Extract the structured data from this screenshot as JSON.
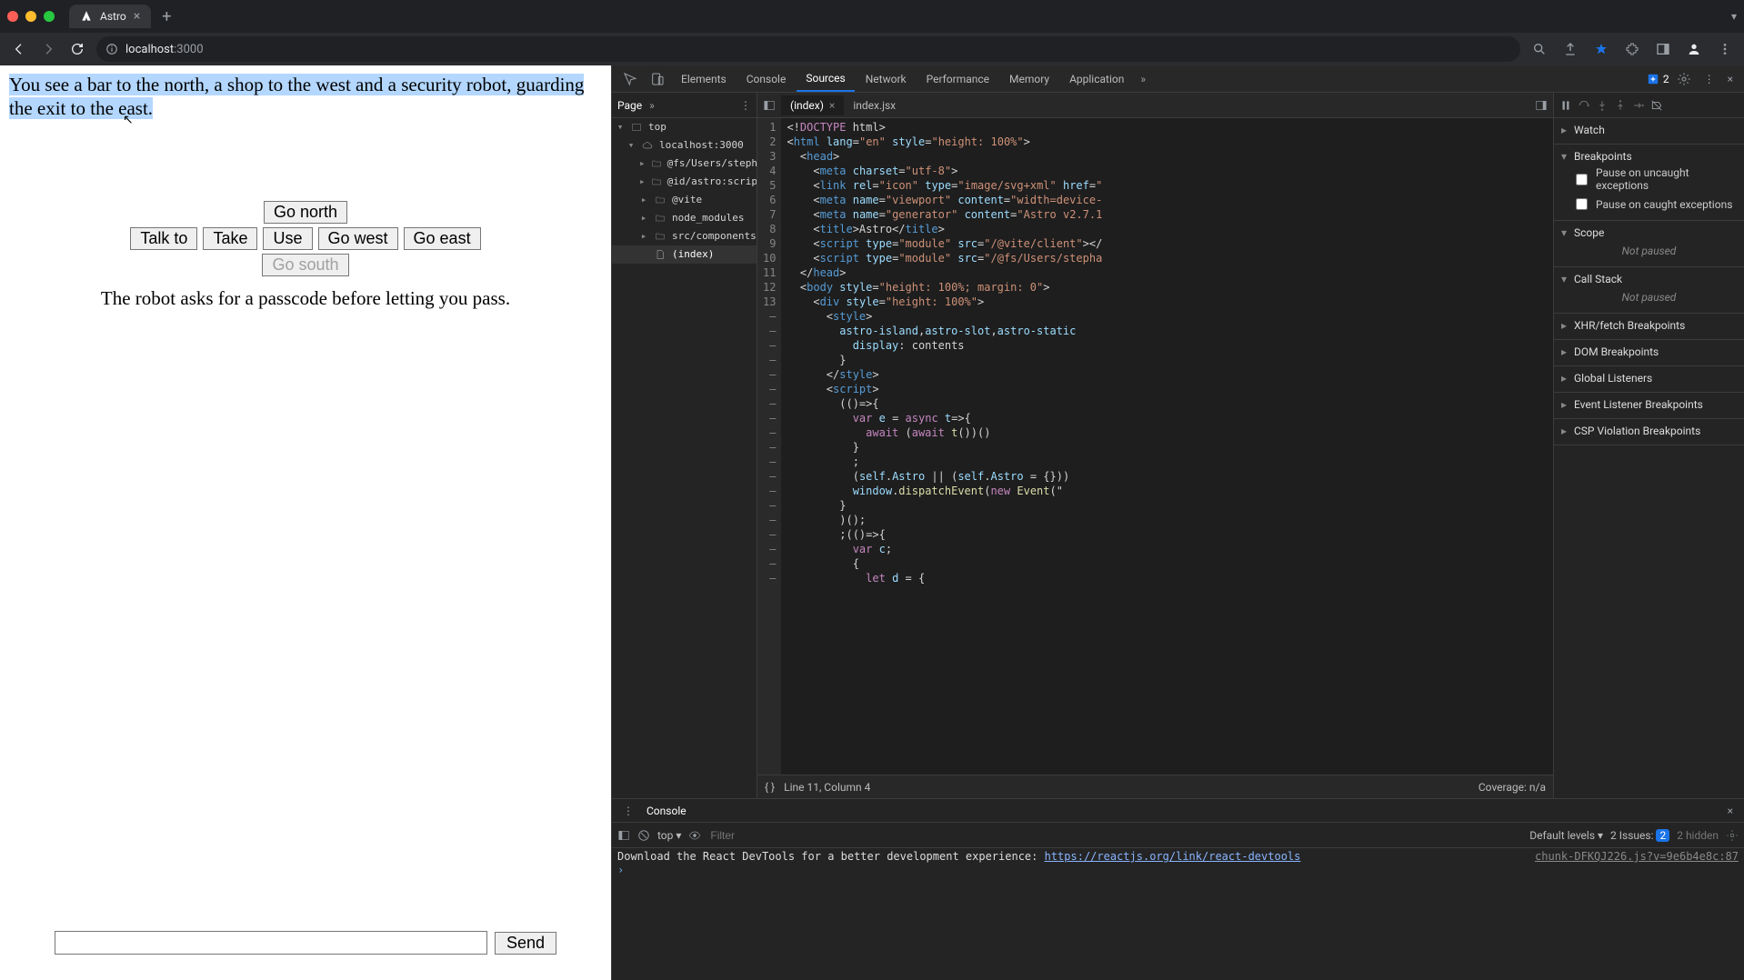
{
  "browser": {
    "tab_title": "Astro",
    "url_host": "localhost",
    "url_port": ":3000"
  },
  "game": {
    "description_hl": "You see a bar to the north, a shop to the west and a security robot, guarding the exit to the east.",
    "buttons": {
      "north": "Go north",
      "talk": "Talk to",
      "take": "Take",
      "use": "Use",
      "west": "Go west",
      "east": "Go east",
      "south": "Go south"
    },
    "dialog": "The robot asks for a passcode before letting you pass.",
    "send_label": "Send",
    "input_value": ""
  },
  "devtools": {
    "top_tabs": [
      "Elements",
      "Console",
      "Sources",
      "Network",
      "Performance",
      "Memory",
      "Application"
    ],
    "issues_count": "2",
    "nav": {
      "tab": "Page",
      "tree": {
        "top": "top",
        "host": "localhost:3000",
        "folders": [
          "@fs/Users/stepha",
          "@id/astro:scripts",
          "@vite",
          "node_modules",
          "src/components"
        ],
        "file": "(index)"
      }
    },
    "editor": {
      "tabs": [
        "(index)",
        "index.jsx"
      ],
      "line_numbers": [
        "1",
        "2",
        "3",
        "4",
        "5",
        "6",
        "7",
        "8",
        "9",
        "10",
        "11",
        "12",
        "13",
        "–",
        "–",
        "–",
        "–",
        "–",
        "–",
        "–",
        "–",
        "–",
        "–",
        "–",
        "–",
        "–",
        "–",
        "–",
        "–",
        "–",
        "–",
        "–"
      ],
      "status_line": "Line 11, Column 4",
      "coverage": "Coverage: n/a"
    },
    "debugger": {
      "sections": {
        "watch": "Watch",
        "breakpoints": "Breakpoints",
        "pause_uncaught": "Pause on uncaught exceptions",
        "pause_caught": "Pause on caught exceptions",
        "scope": "Scope",
        "not_paused": "Not paused",
        "callstack": "Call Stack",
        "xhr": "XHR/fetch Breakpoints",
        "dom": "DOM Breakpoints",
        "global": "Global Listeners",
        "event": "Event Listener Breakpoints",
        "csp": "CSP Violation Breakpoints"
      }
    },
    "console": {
      "tab": "Console",
      "context": "top",
      "filter_ph": "Filter",
      "levels": "Default levels",
      "issues_label": "2 Issues:",
      "issues_pill": "2",
      "hidden": "2 hidden",
      "src_link": "chunk-DFKQJ226.js?v=9e6b4e8c:87",
      "msg_pre": "Download the React DevTools for a better development experience: ",
      "msg_link": "https://reactjs.org/link/react-devtools"
    }
  },
  "code_lines": [
    [
      [
        "",
        "<!"
      ],
      [
        "k",
        "DOCTYPE"
      ],
      [
        "",
        " html>"
      ]
    ],
    [
      [
        "",
        "<"
      ],
      [
        "t",
        "html"
      ],
      [
        "",
        " "
      ],
      [
        "a",
        "lang"
      ],
      [
        "",
        "="
      ],
      [
        "s",
        "\"en\""
      ],
      [
        "",
        " "
      ],
      [
        "a",
        "style"
      ],
      [
        "",
        "="
      ],
      [
        "s",
        "\"height: 100%\""
      ],
      [
        "",
        ">"
      ]
    ],
    [
      [
        "",
        "  <"
      ],
      [
        "t",
        "head"
      ],
      [
        "",
        ">"
      ]
    ],
    [
      [
        "",
        "    <"
      ],
      [
        "t",
        "meta"
      ],
      [
        "",
        " "
      ],
      [
        "a",
        "charset"
      ],
      [
        "",
        "="
      ],
      [
        "s",
        "\"utf-8\""
      ],
      [
        "",
        ">"
      ]
    ],
    [
      [
        "",
        "    <"
      ],
      [
        "t",
        "link"
      ],
      [
        "",
        " "
      ],
      [
        "a",
        "rel"
      ],
      [
        "",
        "="
      ],
      [
        "s",
        "\"icon\""
      ],
      [
        "",
        " "
      ],
      [
        "a",
        "type"
      ],
      [
        "",
        "="
      ],
      [
        "s",
        "\"image/svg+xml\""
      ],
      [
        "",
        " "
      ],
      [
        "a",
        "href"
      ],
      [
        "",
        "="
      ],
      [
        "s",
        "\""
      ]
    ],
    [
      [
        "",
        "    <"
      ],
      [
        "t",
        "meta"
      ],
      [
        "",
        " "
      ],
      [
        "a",
        "name"
      ],
      [
        "",
        "="
      ],
      [
        "s",
        "\"viewport\""
      ],
      [
        "",
        " "
      ],
      [
        "a",
        "content"
      ],
      [
        "",
        "="
      ],
      [
        "s",
        "\"width=device-"
      ]
    ],
    [
      [
        "",
        "    <"
      ],
      [
        "t",
        "meta"
      ],
      [
        "",
        " "
      ],
      [
        "a",
        "name"
      ],
      [
        "",
        "="
      ],
      [
        "s",
        "\"generator\""
      ],
      [
        "",
        " "
      ],
      [
        "a",
        "content"
      ],
      [
        "",
        "="
      ],
      [
        "s",
        "\"Astro v2.7.1"
      ]
    ],
    [
      [
        "",
        "    <"
      ],
      [
        "t",
        "title"
      ],
      [
        "",
        ">Astro</"
      ],
      [
        "t",
        "title"
      ],
      [
        "",
        ">"
      ]
    ],
    [
      [
        "",
        "    <"
      ],
      [
        "t",
        "script"
      ],
      [
        "",
        " "
      ],
      [
        "a",
        "type"
      ],
      [
        "",
        "="
      ],
      [
        "s",
        "\"module\""
      ],
      [
        "",
        " "
      ],
      [
        "a",
        "src"
      ],
      [
        "",
        "="
      ],
      [
        "s",
        "\"/@vite/client\""
      ],
      [
        "",
        "></"
      ]
    ],
    [
      [
        "",
        "    <"
      ],
      [
        "t",
        "script"
      ],
      [
        "",
        " "
      ],
      [
        "a",
        "type"
      ],
      [
        "",
        "="
      ],
      [
        "s",
        "\"module\""
      ],
      [
        "",
        " "
      ],
      [
        "a",
        "src"
      ],
      [
        "",
        "="
      ],
      [
        "s",
        "\"/@fs/Users/stepha"
      ]
    ],
    [
      [
        "",
        "  </"
      ],
      [
        "t",
        "head"
      ],
      [
        "",
        ">"
      ]
    ],
    [
      [
        "",
        "  <"
      ],
      [
        "t",
        "body"
      ],
      [
        "",
        " "
      ],
      [
        "a",
        "style"
      ],
      [
        "",
        "="
      ],
      [
        "s",
        "\"height: 100%; margin: 0\""
      ],
      [
        "",
        ">"
      ]
    ],
    [
      [
        "",
        "    <"
      ],
      [
        "t",
        "div"
      ],
      [
        "",
        " "
      ],
      [
        "a",
        "style"
      ],
      [
        "",
        "="
      ],
      [
        "s",
        "\"height: 100%\""
      ],
      [
        "",
        ">"
      ]
    ],
    [
      [
        "",
        "      <"
      ],
      [
        "t",
        "style"
      ],
      [
        "",
        ">"
      ]
    ],
    [
      [
        "",
        "        "
      ],
      [
        "i",
        "astro-island"
      ],
      [
        "",
        ","
      ],
      [
        "i",
        "astro-slot"
      ],
      [
        "",
        ","
      ],
      [
        "i",
        "astro-static"
      ]
    ],
    [
      [
        "",
        "          "
      ],
      [
        "a",
        "display"
      ],
      [
        "",
        ": contents"
      ]
    ],
    [
      [
        "",
        "        }"
      ]
    ],
    [
      [
        "",
        "      </"
      ],
      [
        "t",
        "style"
      ],
      [
        "",
        ">"
      ]
    ],
    [
      [
        "",
        "      <"
      ],
      [
        "t",
        "script"
      ],
      [
        "",
        ">"
      ]
    ],
    [
      [
        "",
        "        (()=>{"
      ]
    ],
    [
      [
        "",
        "          "
      ],
      [
        "k",
        "var"
      ],
      [
        "",
        " "
      ],
      [
        "i",
        "e"
      ],
      [
        "",
        " = "
      ],
      [
        "k",
        "async"
      ],
      [
        "",
        " "
      ],
      [
        "i",
        "t"
      ],
      [
        "",
        "=>{"
      ]
    ],
    [
      [
        "",
        "            "
      ],
      [
        "k",
        "await"
      ],
      [
        "",
        " ("
      ],
      [
        "k",
        "await"
      ],
      [
        "",
        " "
      ],
      [
        "f",
        "t"
      ],
      [
        "",
        "())()"
      ]
    ],
    [
      [
        "",
        "          }"
      ]
    ],
    [
      [
        "",
        "          ;"
      ]
    ],
    [
      [
        "",
        "          ("
      ],
      [
        "i",
        "self"
      ],
      [
        "",
        "."
      ],
      [
        "i",
        "Astro"
      ],
      [
        "",
        " || ("
      ],
      [
        "i",
        "self"
      ],
      [
        "",
        "."
      ],
      [
        "i",
        "Astro"
      ],
      [
        "",
        " = {}))"
      ]
    ],
    [
      [
        "",
        "          "
      ],
      [
        "i",
        "window"
      ],
      [
        "",
        "."
      ],
      [
        "f",
        "dispatchEvent"
      ],
      [
        "",
        "("
      ],
      [
        "k",
        "new"
      ],
      [
        "",
        " "
      ],
      [
        "f",
        "Event"
      ],
      [
        "",
        "(\""
      ]
    ],
    [
      [
        "",
        "        }"
      ]
    ],
    [
      [
        "",
        "        )();"
      ]
    ],
    [
      [
        "",
        "        ;(()=>{"
      ]
    ],
    [
      [
        "",
        "          "
      ],
      [
        "k",
        "var"
      ],
      [
        "",
        " "
      ],
      [
        "i",
        "c"
      ],
      [
        "",
        ";"
      ]
    ],
    [
      [
        "",
        "          {"
      ]
    ],
    [
      [
        "",
        "            "
      ],
      [
        "k",
        "let"
      ],
      [
        "",
        " "
      ],
      [
        "i",
        "d"
      ],
      [
        "",
        " = {"
      ]
    ]
  ]
}
